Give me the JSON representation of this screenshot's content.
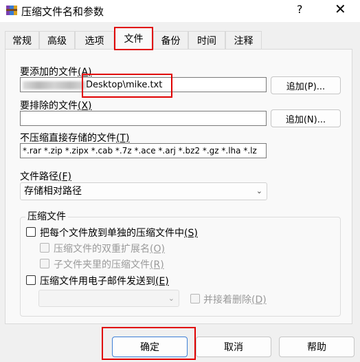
{
  "window": {
    "title": "压缩文件名和参数",
    "help_symbol": "?",
    "close_symbol": "✕",
    "icon": "winrar-icon"
  },
  "tabs": [
    {
      "label": "常规"
    },
    {
      "label": "高级"
    },
    {
      "label": "选项"
    },
    {
      "label": "文件"
    },
    {
      "label": "备份"
    },
    {
      "label": "时间"
    },
    {
      "label": "注释"
    }
  ],
  "active_tab": "文件",
  "files_to_add": {
    "label": "要添加的文件",
    "hotkey": "(A)",
    "value": "Desktop\\mike.txt",
    "append_button": "追加(P)..."
  },
  "files_to_exclude": {
    "label": "要排除的文件",
    "hotkey": "(X)",
    "value": "",
    "append_button": "追加(N)..."
  },
  "store_without_compression": {
    "label": "不压缩直接存储的文件",
    "hotkey": "(T)",
    "value": "*.rar *.zip *.zipx *.cab *.7z *.ace *.arj *.bz2 *.gz *.lha *.lz"
  },
  "file_paths": {
    "label": "文件路径",
    "hotkey": "(F)",
    "selected": "存储相对路径"
  },
  "archives_group": {
    "title": "压缩文件",
    "put_each_file": "把每个文件放到单独的压缩文件中",
    "put_each_file_hotkey": "(S)",
    "double_ext": "压缩文件的双重扩展名",
    "double_ext_hotkey": "(O)",
    "subfolder_archives": "子文件夹里的压缩文件",
    "subfolder_archives_hotkey": "(R)",
    "send_by_email": "压缩文件用电子邮件发送到",
    "send_by_email_hotkey": "(E)",
    "delete_after": "并接着删除",
    "delete_after_hotkey": "(D)"
  },
  "buttons": {
    "ok": "确定",
    "cancel": "取消",
    "help": "帮助"
  },
  "colors": {
    "highlight": "#e00000",
    "background": "#f0f0f0"
  }
}
